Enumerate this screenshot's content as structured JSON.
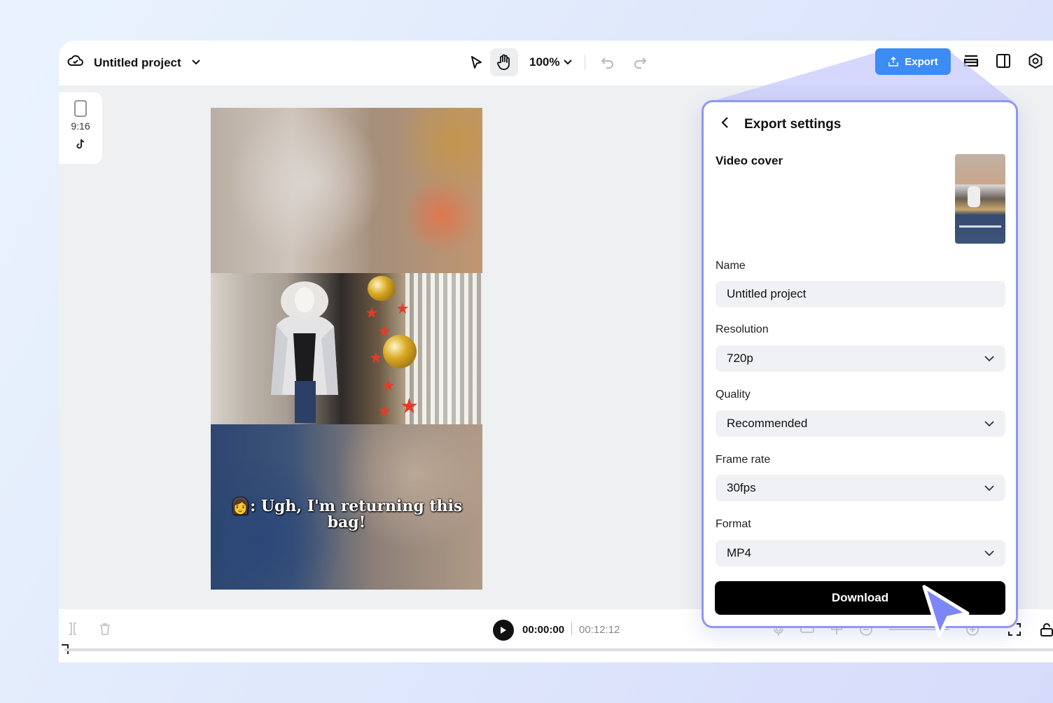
{
  "project": {
    "title": "Untitled project"
  },
  "toolbar": {
    "zoom": "100%",
    "export_label": "Export"
  },
  "ratio_panel": {
    "ratio_label": "9:16"
  },
  "video": {
    "caption": "👩: Ugh, I'm returning this bag!"
  },
  "playback": {
    "current_time": "00:00:00",
    "total_time": "00:12:12"
  },
  "export_panel": {
    "title": "Export settings",
    "video_cover_label": "Video cover",
    "name_label": "Name",
    "name_value": "Untitled project",
    "resolution_label": "Resolution",
    "resolution_value": "720p",
    "quality_label": "Quality",
    "quality_value": "Recommended",
    "frame_rate_label": "Frame rate",
    "frame_rate_value": "30fps",
    "format_label": "Format",
    "format_value": "MP4",
    "download_label": "Download"
  },
  "colors": {
    "accent": "#3d8bf5",
    "panel_border": "#8f97f3",
    "cursor": "#7c86f5"
  }
}
